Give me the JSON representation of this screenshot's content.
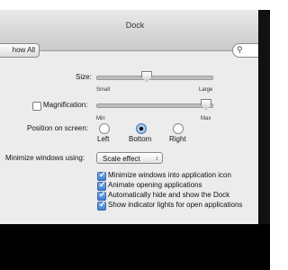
{
  "window": {
    "title": "Dock"
  },
  "toolbar": {
    "show_all_label": "how All",
    "search_icon": "search-icon"
  },
  "size": {
    "label": "Size:",
    "min_label": "Small",
    "max_label": "Large",
    "value": 0.43
  },
  "magnification": {
    "label": "Magnification:",
    "checked": false,
    "min_label": "Min",
    "max_label": "Max",
    "value": 1.0
  },
  "position": {
    "label": "Position on screen:",
    "options": [
      "Left",
      "Bottom",
      "Right"
    ],
    "selected": "Bottom"
  },
  "minimize": {
    "label": "Minimize windows using:",
    "selected": "Scale effect"
  },
  "checkboxes": [
    {
      "label": "Minimize windows into application icon",
      "checked": true
    },
    {
      "label": "Animate opening applications",
      "checked": true
    },
    {
      "label": "Automatically hide and show the Dock",
      "checked": true
    },
    {
      "label": "Show indicator lights for open applications",
      "checked": true
    }
  ],
  "colors": {
    "accent": "#3f7fd0",
    "window_bg": "#ececec"
  }
}
